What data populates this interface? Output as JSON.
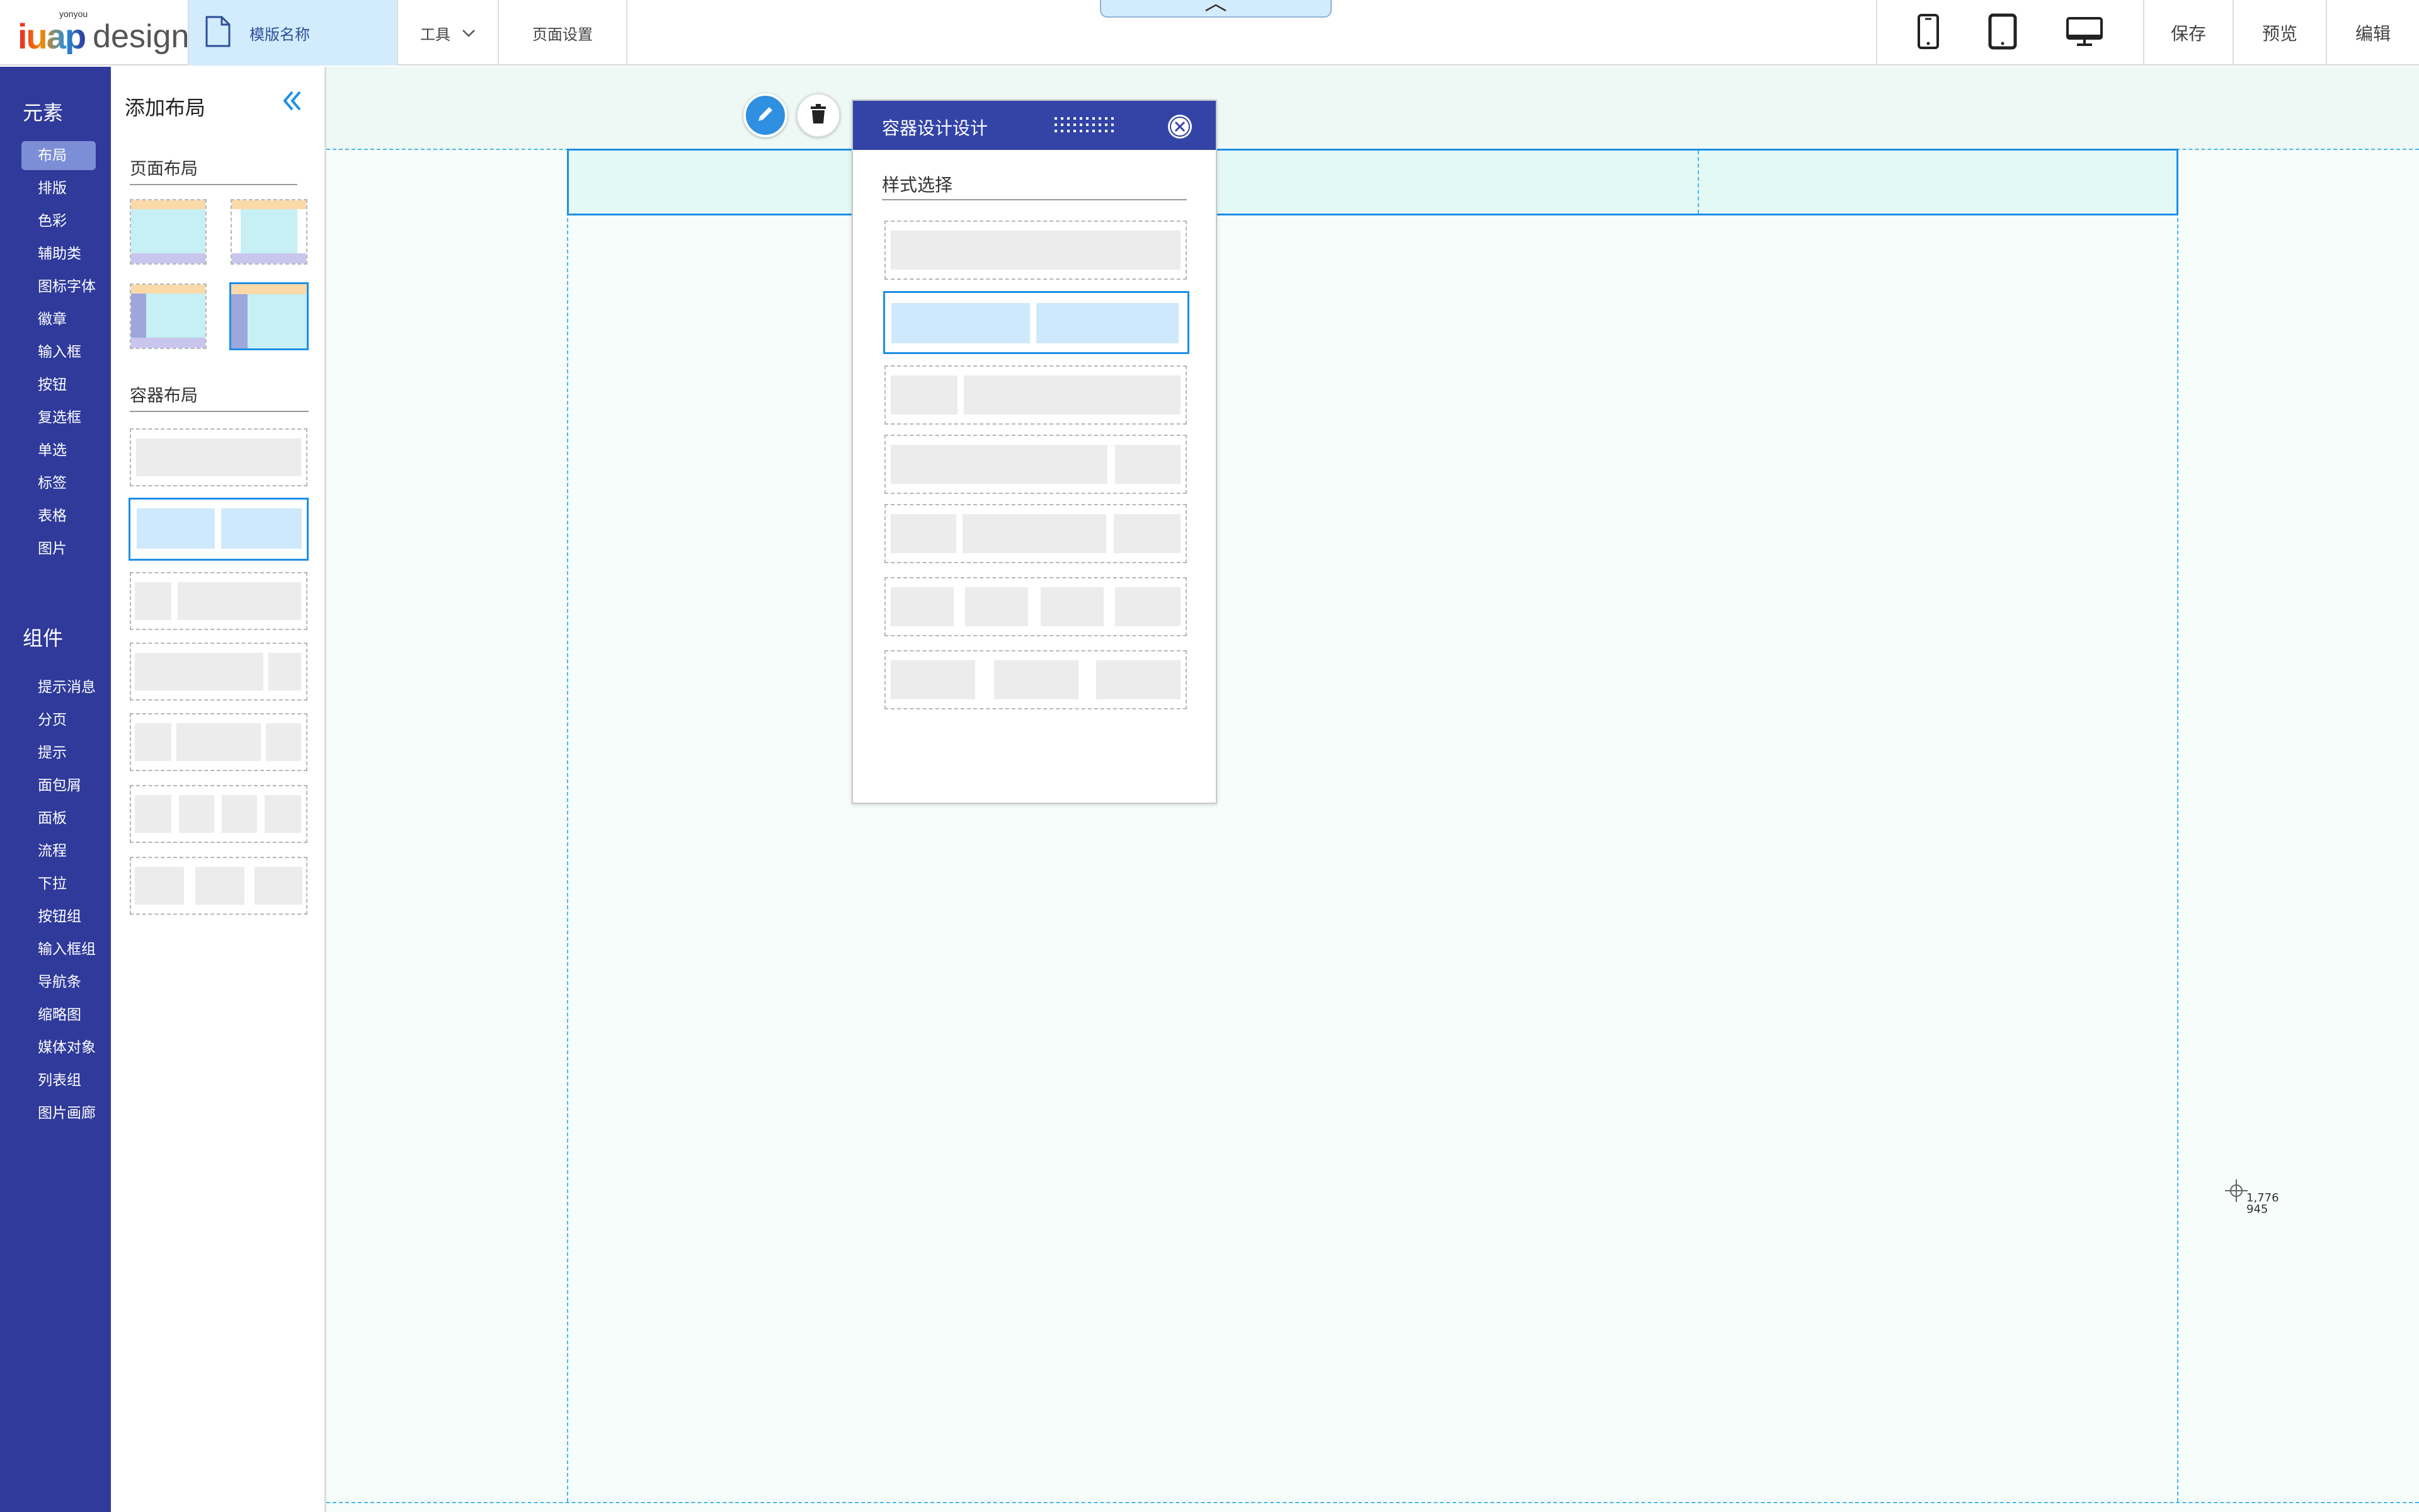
{
  "header": {
    "logo_main": "iuap",
    "logo_word": "design",
    "logo_brand": "yonyou",
    "template_tab": "模版名称",
    "tools_menu": "工具",
    "page_settings": "页面设置",
    "save": "保存",
    "preview": "预览",
    "edit": "编辑",
    "devices": [
      "phone-icon",
      "tablet-icon",
      "desktop-icon"
    ]
  },
  "rail": {
    "elements_heading": "元素",
    "elements": [
      "布局",
      "排版",
      "色彩",
      "辅助类",
      "图标字体",
      "徽章",
      "输入框",
      "按钮",
      "复选框",
      "单选",
      "标签",
      "表格",
      "图片"
    ],
    "active_element": "布局",
    "components_heading": "组件",
    "components": [
      "提示消息",
      "分页",
      "提示",
      "面包屑",
      "面板",
      "流程",
      "下拉",
      "按钮组",
      "输入框组",
      "导航条",
      "缩略图",
      "媒体对象",
      "列表组",
      "图片画廊"
    ]
  },
  "panel": {
    "title": "添加布局",
    "page_layout_title": "页面布局",
    "container_layout_title": "容器布局"
  },
  "dialog": {
    "title": "容器设计设计",
    "subtitle": "样式选择"
  },
  "cursor_readout": {
    "x": "1,776",
    "y": "945"
  },
  "colors": {
    "rail_bg": "#2f3a9b",
    "rail_active": "#7c8ed6",
    "dialog_header": "#3344a6",
    "accent_blue": "#1e8fe6",
    "selected_fill": "#cfe9fc",
    "canvas_bg": "#f6fdfb",
    "guide_line": "#4bb6e8"
  }
}
